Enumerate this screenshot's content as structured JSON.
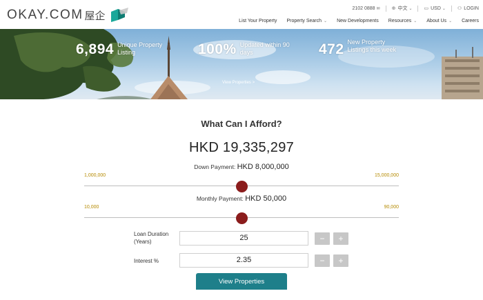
{
  "brand": {
    "logo_text": "OKAY.COM",
    "logo_cjk": "屋企"
  },
  "topbar": {
    "phone": "2102 0888",
    "language": "中文",
    "currency": "USD",
    "login": "LOGIN"
  },
  "nav": {
    "items": [
      {
        "label": "List Your Property",
        "has_dropdown": false
      },
      {
        "label": "Property Search",
        "has_dropdown": true
      },
      {
        "label": "New Developments",
        "has_dropdown": false
      },
      {
        "label": "Resources",
        "has_dropdown": true
      },
      {
        "label": "About Us",
        "has_dropdown": true
      },
      {
        "label": "Careers",
        "has_dropdown": false
      }
    ]
  },
  "hero": {
    "stats": [
      {
        "value": "6,894",
        "label": "Unique Property Listing"
      },
      {
        "value": "100%",
        "label": "Updated within 90 days"
      },
      {
        "value": "472",
        "label": "New Property Listings this week"
      }
    ],
    "link": "View Properties >"
  },
  "calculator": {
    "title": "What Can I Afford?",
    "result": "HKD 19,335,297",
    "down_payment": {
      "label": "Down Payment: ",
      "value": "HKD 8,000,000",
      "min_label": "1,000,000",
      "max_label": "15,000,000",
      "min": 1000000,
      "max": 15000000,
      "current": 8000000
    },
    "monthly_payment": {
      "label": "Monthly Payment: ",
      "value": "HKD 50,000",
      "min_label": "10,000",
      "max_label": "90,000",
      "min": 10000,
      "max": 90000,
      "current": 50000
    },
    "loan_duration": {
      "label": "Loan Duration (Years)",
      "value": "25"
    },
    "interest": {
      "label": "Interest %",
      "value": "2.35"
    },
    "stepper": {
      "minus": "−",
      "plus": "+"
    },
    "cta": "View Properties"
  },
  "colors": {
    "accent": "#1e7f8a",
    "thumb": "#8b1c1c",
    "range_label": "#b58a00",
    "logo_mark": "#1aa89a"
  }
}
